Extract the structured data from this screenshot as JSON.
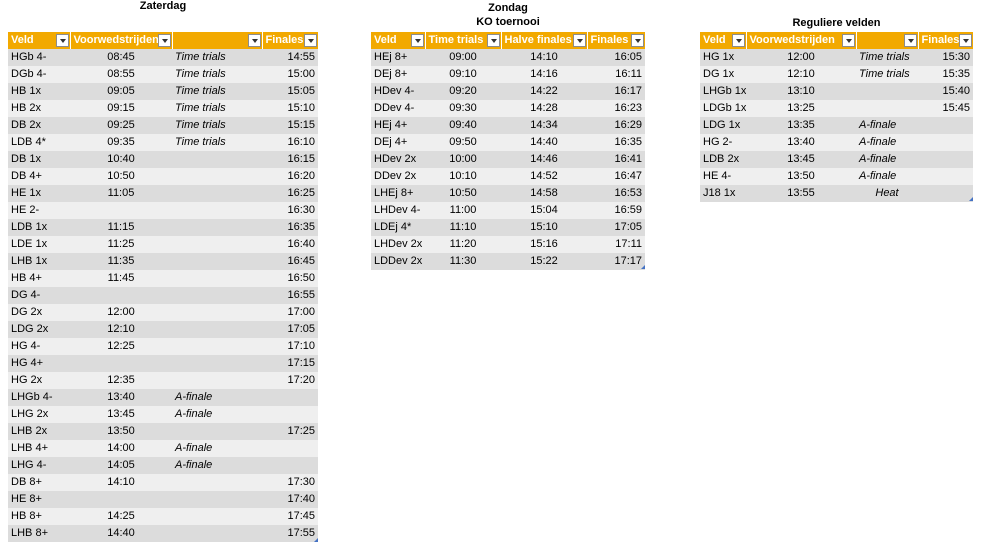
{
  "sat": {
    "heading": "Zaterdag",
    "headers": [
      "Veld",
      "Voorwedstrijden",
      "",
      "Finales"
    ],
    "rows": [
      [
        "HGb 4-",
        "08:45",
        "Time trials",
        "14:55"
      ],
      [
        "DGb 4-",
        "08:55",
        "Time trials",
        "15:00"
      ],
      [
        "HB 1x",
        "09:05",
        "Time trials",
        "15:05"
      ],
      [
        "HB 2x",
        "09:15",
        "Time trials",
        "15:10"
      ],
      [
        "DB 2x",
        "09:25",
        "Time trials",
        "15:15"
      ],
      [
        "LDB 4*",
        "09:35",
        "Time trials",
        "16:10"
      ],
      [
        "DB 1x",
        "10:40",
        "",
        "16:15"
      ],
      [
        "DB 4+",
        "10:50",
        "",
        "16:20"
      ],
      [
        "HE 1x",
        "11:05",
        "",
        "16:25"
      ],
      [
        "HE 2-",
        "",
        "",
        "16:30"
      ],
      [
        "LDB 1x",
        "11:15",
        "",
        "16:35"
      ],
      [
        "LDE 1x",
        "11:25",
        "",
        "16:40"
      ],
      [
        "LHB 1x",
        "11:35",
        "",
        "16:45"
      ],
      [
        "HB 4+",
        "11:45",
        "",
        "16:50"
      ],
      [
        "DG 4-",
        "",
        "",
        "16:55"
      ],
      [
        "DG 2x",
        "12:00",
        "",
        "17:00"
      ],
      [
        "LDG 2x",
        "12:10",
        "",
        "17:05"
      ],
      [
        "HG 4-",
        "12:25",
        "",
        "17:10"
      ],
      [
        "HG 4+",
        "",
        "",
        "17:15"
      ],
      [
        "HG 2x",
        "12:35",
        "",
        "17:20"
      ],
      [
        "LHGb 4-",
        "13:40",
        "A-finale",
        ""
      ],
      [
        "LHG 2x",
        "13:45",
        "A-finale",
        ""
      ],
      [
        "LHB 2x",
        "13:50",
        "",
        "17:25"
      ],
      [
        "LHB 4+",
        "14:00",
        "A-finale",
        ""
      ],
      [
        "LHG 4-",
        "14:05",
        "A-finale",
        ""
      ],
      [
        "DB 8+",
        "14:10",
        "",
        "17:30"
      ],
      [
        "HE 8+",
        "",
        "",
        "17:40"
      ],
      [
        "HB 8+",
        "14:25",
        "",
        "17:45"
      ],
      [
        "LHB 8+",
        "14:40",
        "",
        "17:55"
      ]
    ]
  },
  "sun": {
    "heading_day": "Zondag",
    "heading_sub": "KO toernooi",
    "headers": [
      "Veld",
      "Time trials",
      "Halve finales",
      "Finales"
    ],
    "rows": [
      [
        "HEj 8+",
        "09:00",
        "14:10",
        "16:05"
      ],
      [
        "DEj 8+",
        "09:10",
        "14:16",
        "16:11"
      ],
      [
        "HDev 4-",
        "09:20",
        "14:22",
        "16:17"
      ],
      [
        "DDev 4-",
        "09:30",
        "14:28",
        "16:23"
      ],
      [
        "HEj 4+",
        "09:40",
        "14:34",
        "16:29"
      ],
      [
        "DEj 4+",
        "09:50",
        "14:40",
        "16:35"
      ],
      [
        "HDev 2x",
        "10:00",
        "14:46",
        "16:41"
      ],
      [
        "DDev 2x",
        "10:10",
        "14:52",
        "16:47"
      ],
      [
        "LHEj 8+",
        "10:50",
        "14:58",
        "16:53"
      ],
      [
        "LHDev 4-",
        "11:00",
        "15:04",
        "16:59"
      ],
      [
        "LDEj 4*",
        "11:10",
        "15:10",
        "17:05"
      ],
      [
        "LHDev 2x",
        "11:20",
        "15:16",
        "17:11"
      ],
      [
        "LDDev 2x",
        "11:30",
        "15:22",
        "17:17"
      ]
    ]
  },
  "reg": {
    "heading": "Reguliere velden",
    "headers": [
      "Veld",
      "Voorwedstrijden",
      "",
      "Finales"
    ],
    "rows": [
      [
        "HG 1x",
        "12:00",
        "Time trials",
        "15:30"
      ],
      [
        "DG 1x",
        "12:10",
        "Time trials",
        "15:35"
      ],
      [
        "LHGb 1x",
        "13:10",
        "",
        "15:40"
      ],
      [
        "LDGb 1x",
        "13:25",
        "",
        "15:45"
      ],
      [
        "LDG 1x",
        "13:35",
        "A-finale",
        ""
      ],
      [
        "HG 2-",
        "13:40",
        "A-finale",
        ""
      ],
      [
        "LDB 2x",
        "13:45",
        "A-finale",
        ""
      ],
      [
        "HE 4-",
        "13:50",
        "A-finale",
        ""
      ],
      [
        "J18 1x",
        "13:55",
        "Heat",
        ""
      ]
    ]
  },
  "colors": {
    "header": "#f2a900",
    "band_dark": "#dcdcdc",
    "band_light": "#efefef"
  }
}
